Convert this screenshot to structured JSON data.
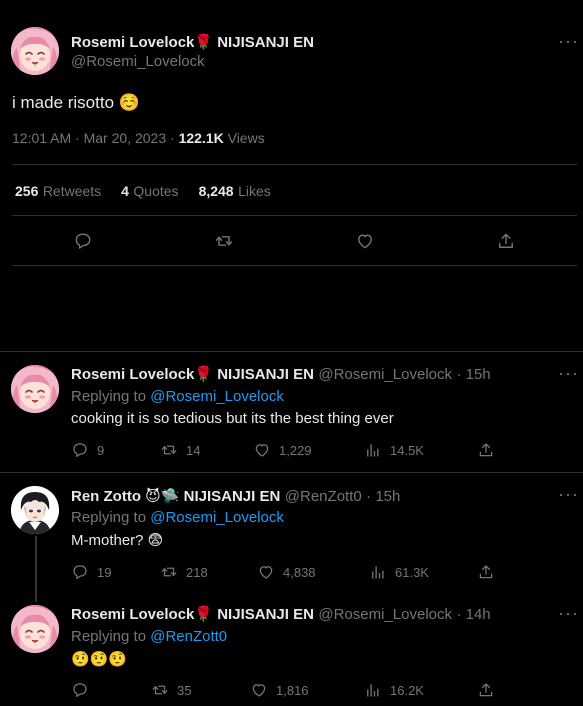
{
  "main_tweet": {
    "display_name": "Rosemi Lovelock🌹 NIJISANJI EN",
    "handle": "@Rosemi_Lovelock",
    "text": "i made risotto ☺️",
    "time": "12:01 AM",
    "date": "Mar 20, 2023",
    "views_count": "122.1K",
    "views_label": "Views",
    "retweets_count": "256",
    "retweets_label": "Retweets",
    "quotes_count": "4",
    "quotes_label": "Quotes",
    "likes_count": "8,248",
    "likes_label": "Likes",
    "more_label": "···"
  },
  "replies": [
    {
      "display_name": "Rosemi Lovelock🌹 NIJISANJI EN",
      "handle": "@Rosemi_Lovelock",
      "age": "· 15h",
      "replying_prefix": "Replying to",
      "replying_to": "@Rosemi_Lovelock",
      "text": "cooking it is so tedious but its the best thing ever",
      "reply_count": "9",
      "retweet_count": "14",
      "like_count": "1,229",
      "view_count": "14.5K"
    },
    {
      "display_name": "Ren Zotto 😈🛸 NIJISANJI EN",
      "handle": "@RenZott0",
      "age": "· 15h",
      "replying_prefix": "Replying to",
      "replying_to": "@Rosemi_Lovelock",
      "text": "M-mother? 😨",
      "reply_count": "19",
      "retweet_count": "218",
      "like_count": "4,838",
      "view_count": "61.3K"
    },
    {
      "display_name": "Rosemi Lovelock🌹 NIJISANJI EN",
      "handle": "@Rosemi_Lovelock",
      "age": "· 14h",
      "replying_prefix": "Replying to",
      "replying_to": "@RenZott0",
      "text": "🤨🤨🤨",
      "reply_count": "",
      "retweet_count": "35",
      "like_count": "1,816",
      "view_count": "16.2K"
    }
  ],
  "colors": {
    "background": "#000000",
    "text": "#e7e9ea",
    "muted": "#71767b",
    "link": "#1d9bf0",
    "divider": "#2f3336"
  }
}
